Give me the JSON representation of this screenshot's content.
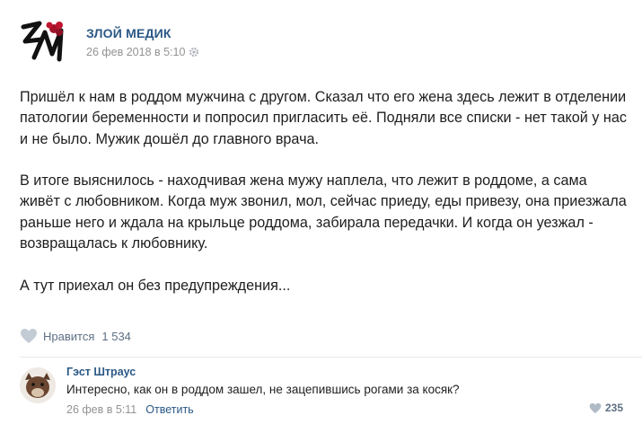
{
  "post": {
    "author": "ЗЛОЙ МЕДИК",
    "date": "26 фев 2018 в 5:10",
    "paragraphs": [
      "Пришёл к нам в роддом мужчина с другом. Сказал что его жена здесь лежит в отделении патологии беременности и попросил пригласить её. Подняли все списки - нет такой у нас и не было. Мужик дошёл до главного врача.",
      "В итоге выяснилось - находчивая жена мужу наплела, что лежит в роддоме, а сама живёт с любовником. Когда муж звонил, мол, сейчас приеду, еды привезу, она приезжала раньше него и ждала на крыльце роддома, забирала передачки. И когда он уезжал - возвращалась к любовнику.",
      "А тут приехал он без предупреждения..."
    ],
    "likes_label": "Нравится",
    "likes_count": "1 534"
  },
  "comment": {
    "author": "Гэст Штраус",
    "text": "Интересно, как он в роддом зашел, не зацепившись рогами за косяк?",
    "date": "26 фев в 5:11",
    "reply_label": "Ответить",
    "likes_count": "235"
  },
  "colors": {
    "link": "#2a5885",
    "muted": "#939393",
    "accent_red": "#a3142b"
  },
  "icons": {
    "logo": "zm-logo-with-red-flower",
    "settings": "gear-icon",
    "like": "heart-icon"
  }
}
